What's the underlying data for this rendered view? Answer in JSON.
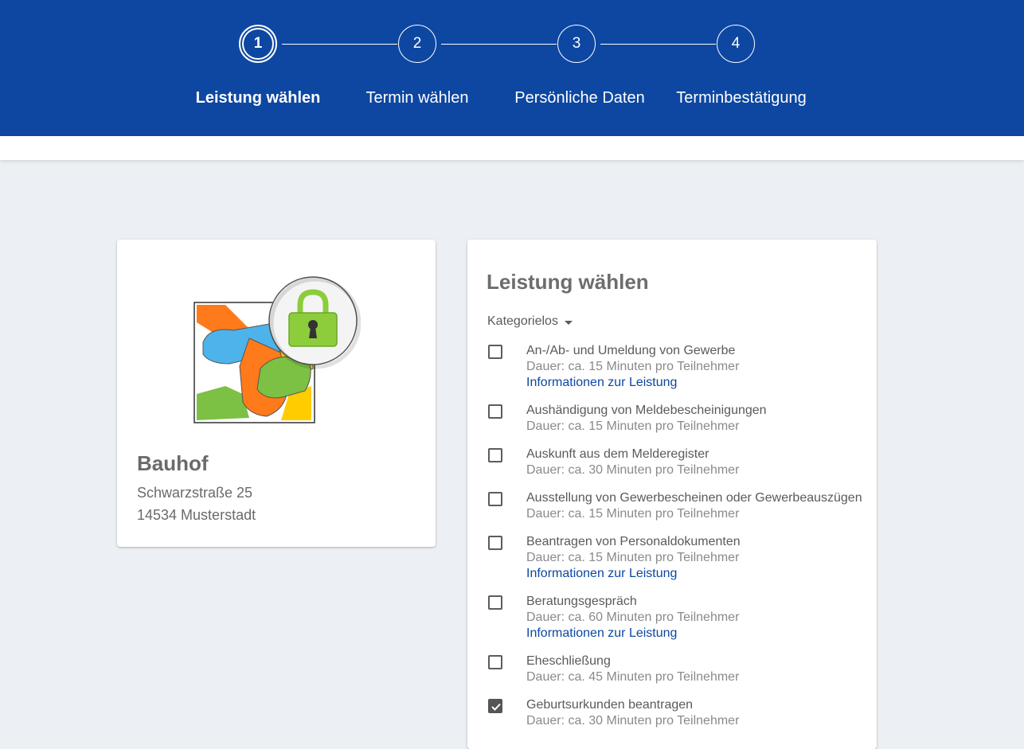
{
  "stepper": {
    "steps": [
      {
        "number": "1",
        "label": "Leistung wählen",
        "active": true
      },
      {
        "number": "2",
        "label": "Termin wählen",
        "active": false
      },
      {
        "number": "3",
        "label": "Persönliche Daten",
        "active": false
      },
      {
        "number": "4",
        "label": "Terminbestätigung",
        "active": false
      }
    ]
  },
  "location": {
    "name": "Bauhof",
    "street": "Schwarzstraße 25",
    "city": "14534 Musterstadt",
    "logo_icon": "hands-lock-logo-icon"
  },
  "services": {
    "title": "Leistung wählen",
    "category": "Kategorielos",
    "items": [
      {
        "name": "An-/Ab- und Umeldung von Gewerbe",
        "duration": "Dauer: ca. 15 Minuten pro Teilnehmer",
        "info": "Informationen zur Leistung",
        "checked": false
      },
      {
        "name": "Aushändigung von Meldebescheinigungen",
        "duration": "Dauer: ca. 15 Minuten pro Teilnehmer",
        "info": "",
        "checked": false
      },
      {
        "name": "Auskunft aus dem Melderegister",
        "duration": "Dauer: ca. 30 Minuten pro Teilnehmer",
        "info": "",
        "checked": false
      },
      {
        "name": "Ausstellung von Gewerbescheinen oder Gewerbeauszügen",
        "duration": "Dauer: ca. 15 Minuten pro Teilnehmer",
        "info": "",
        "checked": false
      },
      {
        "name": "Beantragen von Personaldokumenten",
        "duration": "Dauer: ca. 15 Minuten pro Teilnehmer",
        "info": "Informationen zur Leistung",
        "checked": false
      },
      {
        "name": "Beratungsgespräch",
        "duration": "Dauer: ca. 60 Minuten pro Teilnehmer",
        "info": "Informationen zur Leistung",
        "checked": false
      },
      {
        "name": "Eheschließung",
        "duration": "Dauer: ca. 45 Minuten pro Teilnehmer",
        "info": "",
        "checked": false
      },
      {
        "name": "Geburtsurkunden beantragen",
        "duration": "Dauer: ca. 30 Minuten pro Teilnehmer",
        "info": "",
        "checked": true
      }
    ]
  },
  "colors": {
    "header": "#0d47a1",
    "page_background": "#eceff3",
    "link": "#0d47a1"
  }
}
